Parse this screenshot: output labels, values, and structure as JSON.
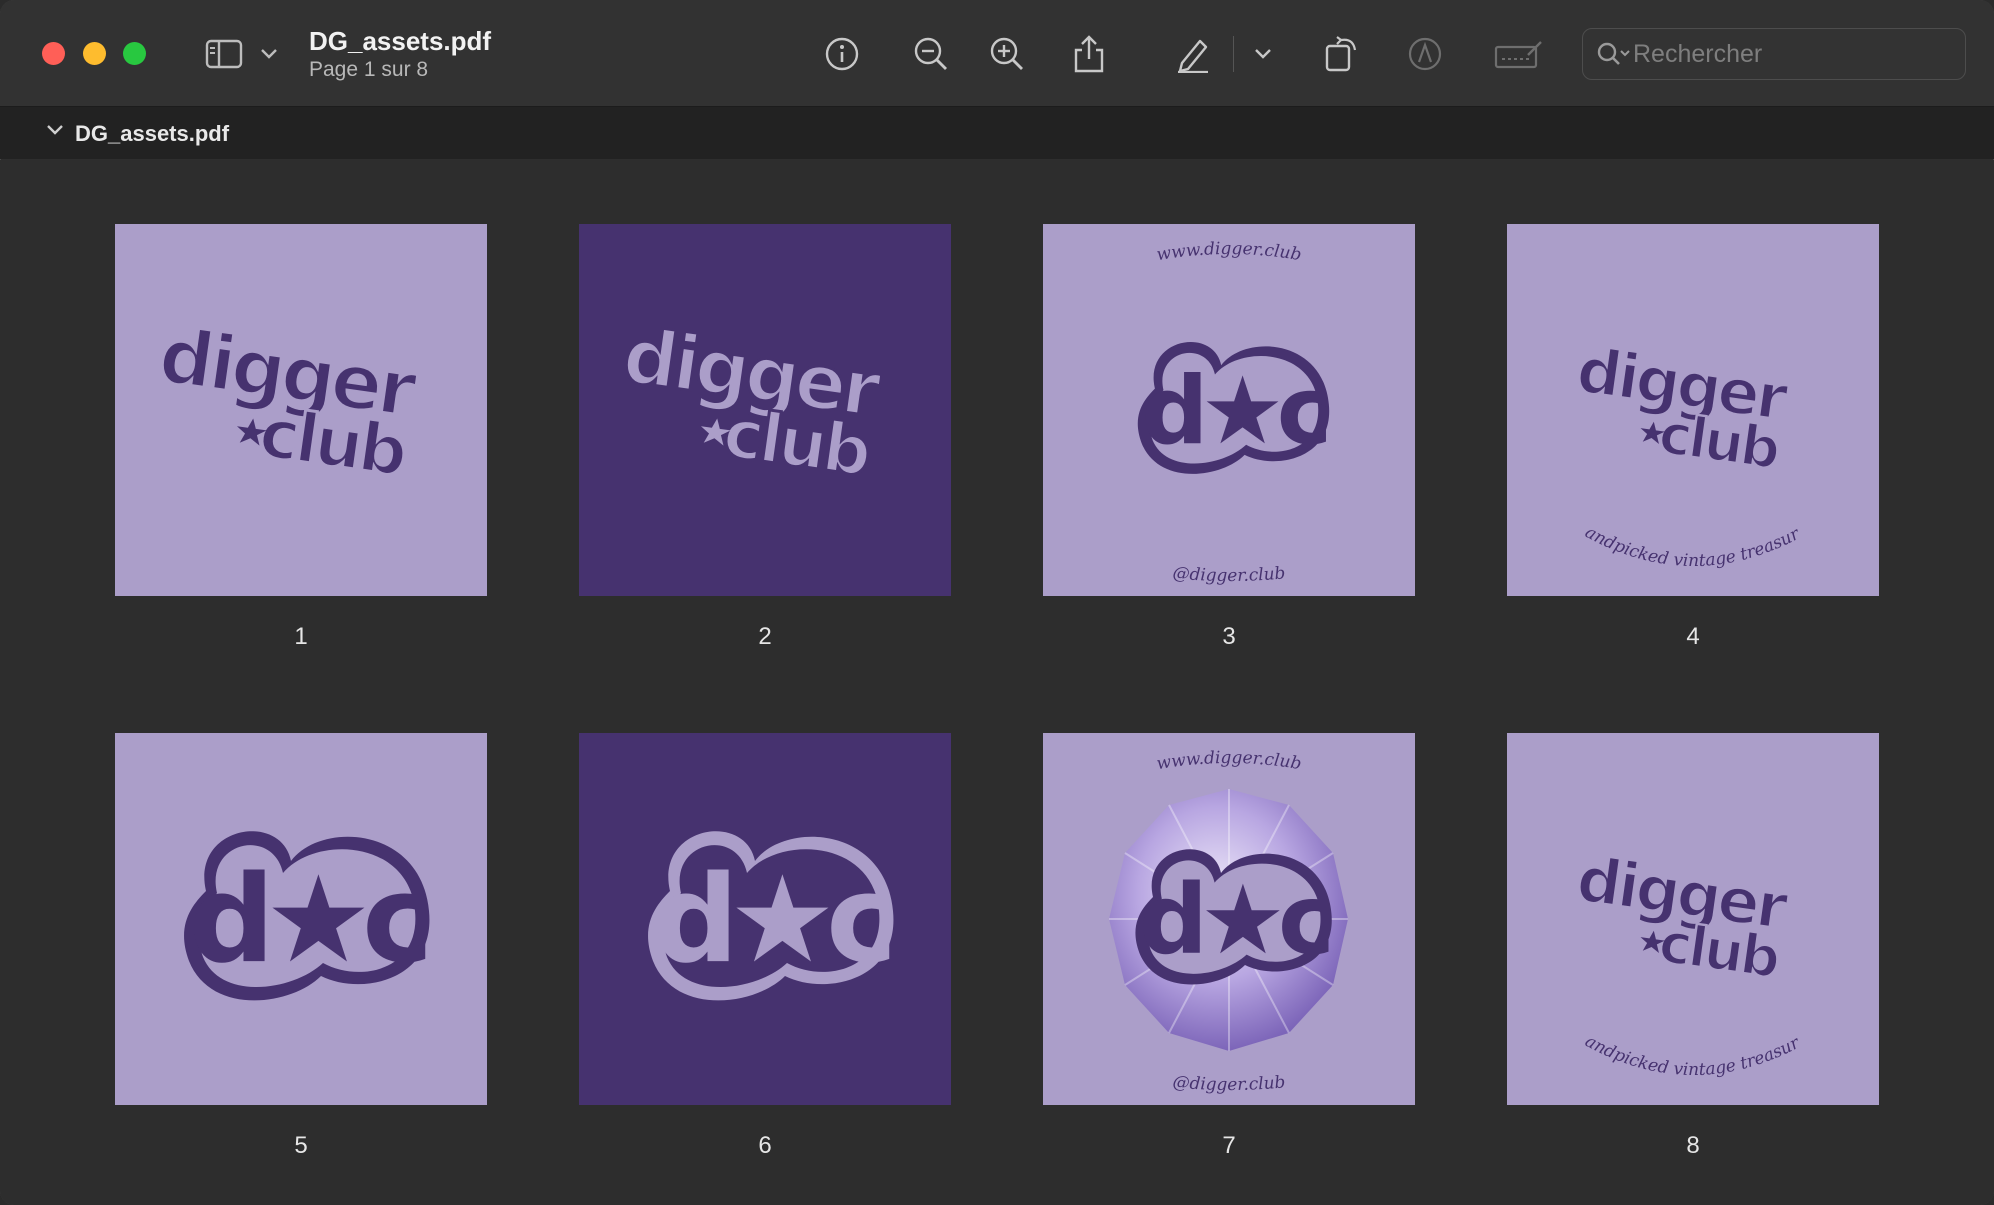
{
  "window": {
    "title": "DG_assets.pdf",
    "subtitle": "Page 1 sur 8"
  },
  "toolbar": {
    "icons": [
      "sidebar-icon",
      "chevron-down-icon",
      "info-icon",
      "zoom-out-icon",
      "zoom-in-icon",
      "share-icon",
      "markup-pen-icon",
      "chevron-down-icon",
      "rotate-icon",
      "highlight-icon",
      "signature-icon"
    ]
  },
  "search": {
    "placeholder": "Rechercher"
  },
  "outline": {
    "label": "DG_assets.pdf"
  },
  "colors": {
    "light_page": "#ab9ec9",
    "dark_page": "#46326f",
    "ink": "#46326f"
  },
  "pages": [
    {
      "number": "1",
      "bg": "light",
      "art": "wordmark"
    },
    {
      "number": "2",
      "bg": "dark",
      "art": "wordmark"
    },
    {
      "number": "3",
      "bg": "light",
      "art": "monogram",
      "top_text": "www.digger.club",
      "bottom_text": "@digger.club"
    },
    {
      "number": "4",
      "bg": "light",
      "art": "wordmark",
      "bottom_text": "Handpicked vintage treasures"
    },
    {
      "number": "5",
      "bg": "light",
      "art": "monogram"
    },
    {
      "number": "6",
      "bg": "dark",
      "art": "monogram"
    },
    {
      "number": "7",
      "bg": "light",
      "art": "monogram-crystal",
      "top_text": "www.digger.club",
      "bottom_text": "@digger.club"
    },
    {
      "number": "8",
      "bg": "light",
      "art": "wordmark",
      "bottom_text": "Handpicked vintage treasures"
    }
  ],
  "logo": {
    "word1": "digger",
    "word2": "club",
    "monogram": "d★c"
  }
}
